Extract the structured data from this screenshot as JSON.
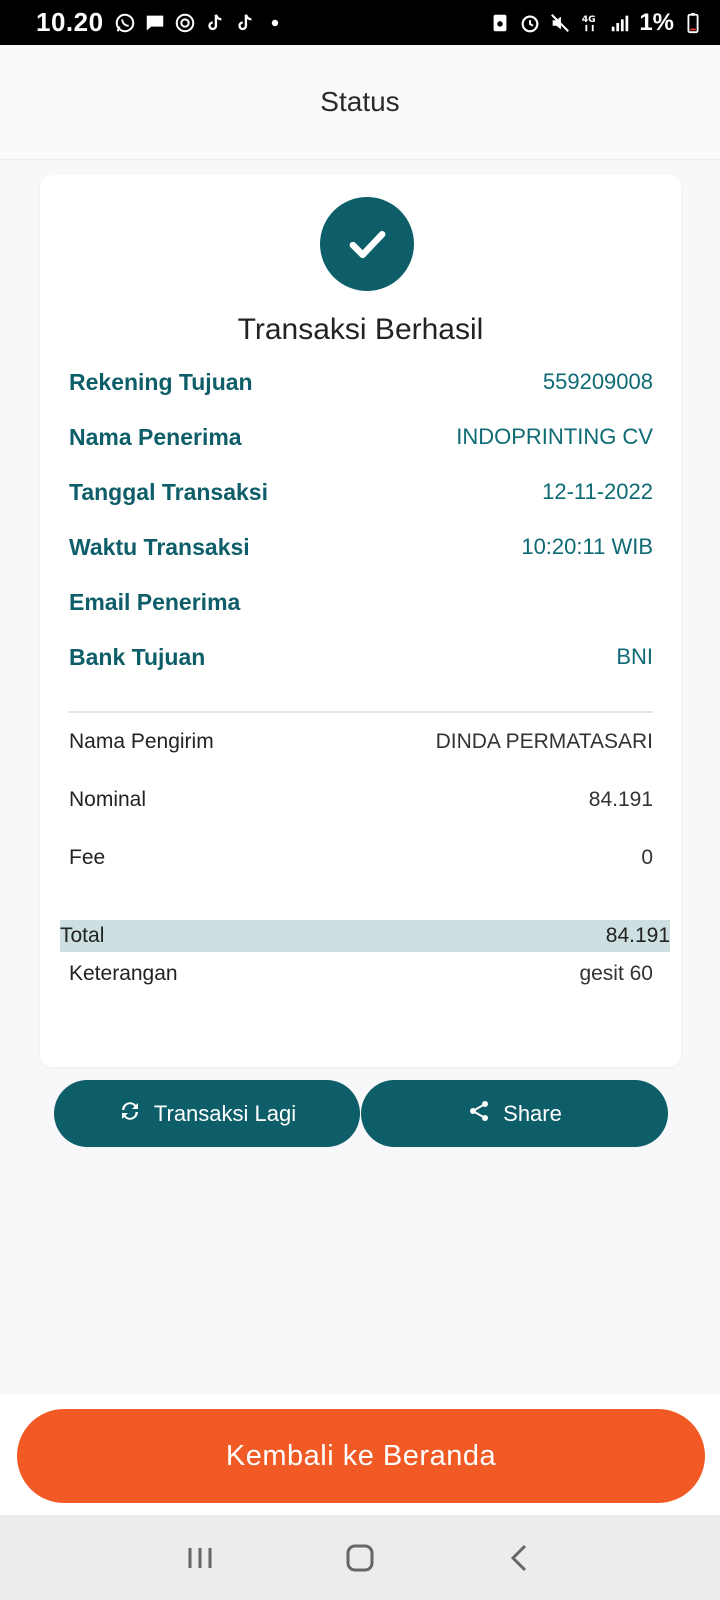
{
  "status_bar": {
    "time": "10.20",
    "battery": "1%",
    "icons": [
      "whatsapp-icon",
      "message-icon",
      "sync-icon",
      "tiktok-icon",
      "tiktok-icon",
      "dot-icon",
      "nfc-icon",
      "alarm-icon",
      "mute-icon",
      "4g-icon",
      "signal-icon",
      "battery-icon"
    ]
  },
  "appbar": {
    "title": "Status"
  },
  "result": {
    "icon": "check-icon",
    "title": "Transaksi Berhasil"
  },
  "details": [
    {
      "label": "Rekening Tujuan",
      "value": "559209008"
    },
    {
      "label": "Nama Penerima",
      "value": "INDOPRINTING CV"
    },
    {
      "label": "Tanggal Transaksi",
      "value": "12-11-2022"
    },
    {
      "label": "Waktu Transaksi",
      "value": "10:20:11 WIB"
    },
    {
      "label": "Email Penerima",
      "value": ""
    },
    {
      "label": "Bank Tujuan",
      "value": "BNI"
    }
  ],
  "summary": [
    {
      "label": "Nama Pengirim",
      "value": "DINDA PERMATASARI"
    },
    {
      "label": "Nominal",
      "value": "84.191"
    },
    {
      "label": "Fee",
      "value": "0"
    }
  ],
  "total": {
    "label": "Total",
    "value": "84.191"
  },
  "note": {
    "label": "Keterangan",
    "value": "gesit 60"
  },
  "actions": {
    "again_label": "Transaksi Lagi",
    "share_label": "Share"
  },
  "footer": {
    "home_label": "Kembali ke Beranda"
  },
  "colors": {
    "accent": "#0e5e69",
    "primary_button": "#f15a24",
    "total_highlight": "#cddfe0"
  }
}
